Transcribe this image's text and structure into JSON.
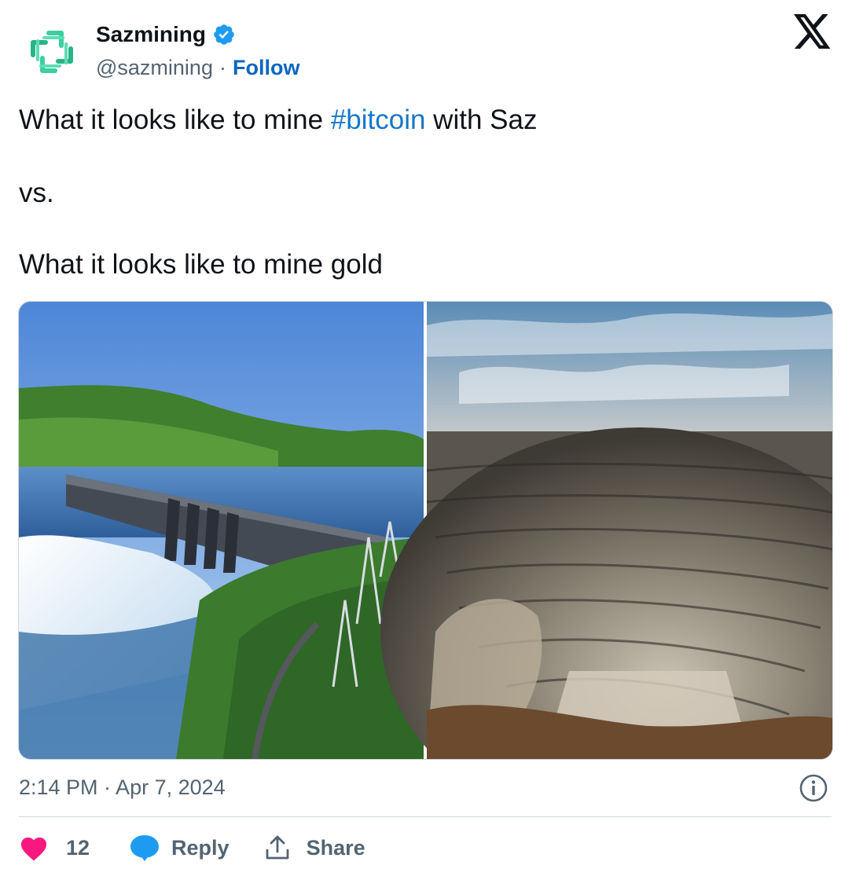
{
  "author": {
    "name": "Sazmining",
    "handle": "@sazmining",
    "separator": "·",
    "follow_label": "Follow"
  },
  "post": {
    "line1_prefix": "What it looks like to mine ",
    "hashtag": "#bitcoin",
    "line1_suffix": " with Saz",
    "line2": "vs.",
    "line3": "What it looks like to mine gold"
  },
  "meta": {
    "timestamp": "2:14 PM · Apr 7, 2024"
  },
  "actions": {
    "like_count": "12",
    "reply_label": "Reply",
    "share_label": "Share"
  },
  "colors": {
    "link": "#1577c8",
    "verified": "#1d9bf0",
    "like": "#f91880",
    "reply_bubble": "#1d9bf0",
    "logo_green": "#2fbf8f"
  },
  "icons": [
    "sazmining-logo-icon",
    "verified-badge-icon",
    "x-logo-icon",
    "info-icon",
    "heart-icon",
    "reply-icon",
    "share-icon"
  ]
}
